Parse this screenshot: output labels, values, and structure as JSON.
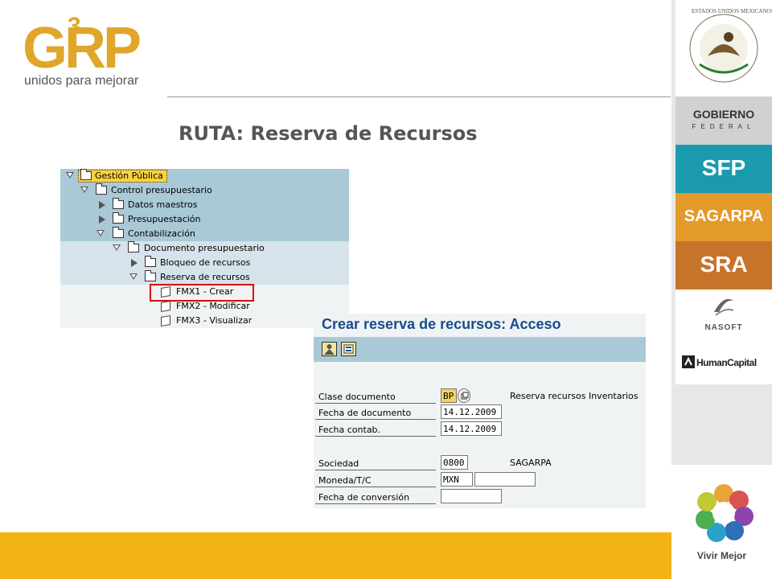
{
  "logo": {
    "main": "GRP",
    "superscript": "3",
    "tagline": "unidos para mejorar"
  },
  "title": "RUTA: Reserva de Recursos",
  "tree": [
    {
      "label": "Gestión Pública",
      "expanded": true,
      "icon": "folder-open-icon"
    },
    {
      "label": "Control presupuestario",
      "expanded": true,
      "icon": "folder-open-icon"
    },
    {
      "label": "Datos maestros",
      "expanded": false,
      "icon": "folder-icon"
    },
    {
      "label": "Presupuestación",
      "expanded": false,
      "icon": "folder-icon"
    },
    {
      "label": "Contabilización",
      "expanded": true,
      "icon": "folder-open-icon"
    },
    {
      "label": "Documento presupuestario",
      "expanded": true,
      "icon": "folder-open-icon"
    },
    {
      "label": "Bloqueo de recursos",
      "expanded": false,
      "icon": "folder-icon"
    },
    {
      "label": "Reserva de recursos",
      "expanded": true,
      "icon": "folder-open-icon"
    },
    {
      "label": "FMX1 - Crear",
      "icon": "transaction-cube-icon"
    },
    {
      "label": "FMX2 - Modificar",
      "icon": "transaction-cube-icon"
    },
    {
      "label": "FMX3 - Visualizar",
      "icon": "transaction-cube-icon"
    }
  ],
  "dialog": {
    "title": "Crear reserva de recursos: Acceso",
    "fields": {
      "clase": {
        "label": "Clase documento",
        "value": "BP",
        "desc": "Reserva recursos Inventarios"
      },
      "fecha_doc": {
        "label": "Fecha de documento",
        "value": "14.12.2009"
      },
      "fecha_contab": {
        "label": "Fecha contab.",
        "value": "14.12.2009"
      },
      "sociedad": {
        "label": "Sociedad",
        "value": "0800",
        "desc": "SAGARPA"
      },
      "moneda": {
        "label": "Moneda/T/C",
        "value": "MXN",
        "rate": ""
      },
      "fecha_conv": {
        "label": "Fecha de conversión",
        "value": ""
      }
    }
  },
  "sidebar": {
    "seal_text": "ESTADOS UNIDOS MEXICANOS",
    "gobierno": "GOBIERNO",
    "federal": "FEDERAL",
    "sfp": "SFP",
    "sagarpa": "SAGARPA",
    "sra": "SRA",
    "nasoft": "NASOFT",
    "humancapital": "HumanCapital",
    "vivir": "Vivir Mejor"
  },
  "colors": {
    "accent": "#f3b215",
    "sap_blue": "#a9c9d6",
    "title_blue": "#1a4b8c",
    "highlight_red": "#d00000"
  }
}
